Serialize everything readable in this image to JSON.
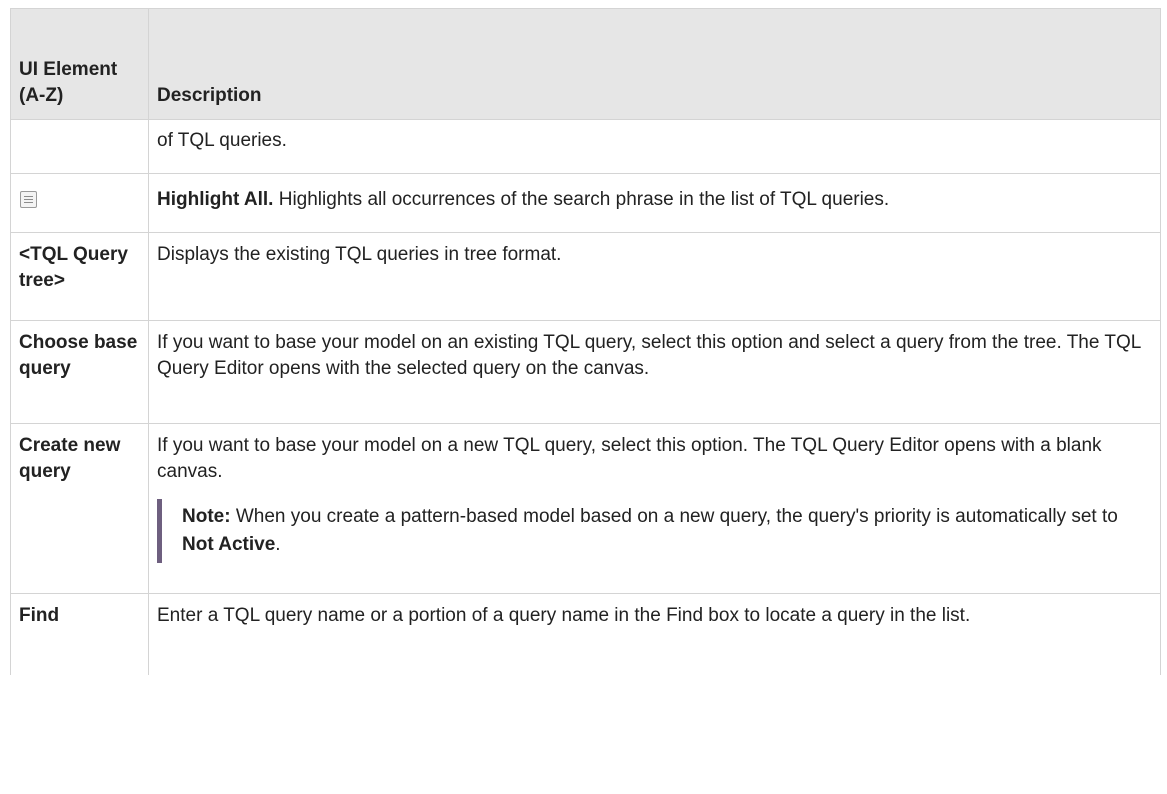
{
  "table": {
    "header": {
      "col1": "UI Element (A-Z)",
      "col2": "Description"
    },
    "rows": [
      {
        "element": "",
        "description": "of TQL queries."
      },
      {
        "element_icon": "highlight-all-icon",
        "description_bold": "Highlight All.",
        "description": "Highlights all occurrences of the search phrase in the list of TQL queries."
      },
      {
        "element": "<TQL Query tree>",
        "description": "Displays the existing TQL queries in tree format."
      },
      {
        "element": "Choose base query",
        "description": "If you want to base your model on an existing TQL query, select this option and select a query from the tree. The TQL Query Editor opens with the selected query on the canvas."
      },
      {
        "element": "Create new query",
        "description": "If you want to base your model on a new TQL query, select this option. The TQL Query Editor opens with a blank canvas.",
        "note": {
          "label": "Note:",
          "text_before": "When you create a pattern-based model based on a new query, the query's priority is automatically set to",
          "bold_value": "Not Active",
          "text_after": "."
        }
      },
      {
        "element": "Find",
        "description": "Enter a TQL query name or a portion of a query name in the Find box to locate a query in the list."
      }
    ]
  }
}
